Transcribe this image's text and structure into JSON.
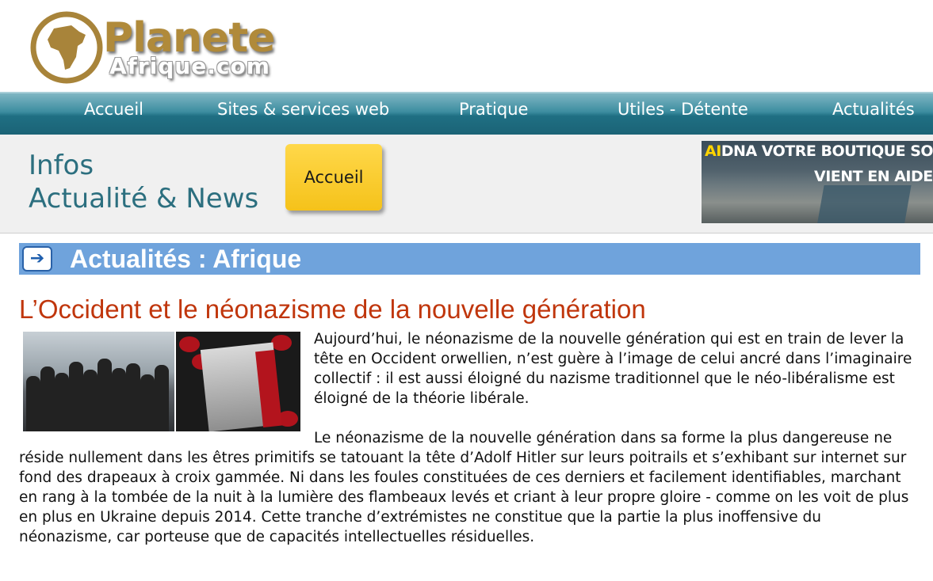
{
  "logo": {
    "main": "Planete",
    "sub": "Afrique.com",
    "icon": "africa-globe-icon"
  },
  "nav": {
    "items": [
      {
        "label": "Accueil"
      },
      {
        "label": "Sites & services web"
      },
      {
        "label": "Pratique"
      },
      {
        "label": "Utiles - Détente"
      },
      {
        "label": "Actualités"
      }
    ]
  },
  "infos": {
    "title_line1": "Infos",
    "title_line2": "Actualité & News",
    "accueil_button": "Accueil"
  },
  "ad": {
    "line1_accent": "AI",
    "line1_rest": "DNA VOTRE BOUTIQUE SO",
    "line2": "VIENT EN AIDE"
  },
  "section": {
    "title": "Actualités : Afrique",
    "icon": "arrow-right-icon"
  },
  "article": {
    "title": "L’Occident et le néonazisme de la nouvelle génération",
    "paragraph1": "Aujourd’hui, le néonazisme de la nouvelle génération qui est en train de lever la tête en Occident orwellien, n’est guère à l’image de celui ancré dans l’imaginaire collectif : il est aussi éloigné du nazisme traditionnel que le néo-libéralisme est éloigné de la théorie libérale.",
    "paragraph2": "Le néonazisme de la nouvelle génération dans sa forme la plus dangereuse ne réside nullement dans les êtres primitifs se tatouant la tête d’Adolf Hitler sur leurs poitrails et s’exhibant sur internet sur fond des drapeaux à croix gammée. Ni dans les foules constituées de ces derniers et facilement identifiables, marchant en rang à la tombée de la nuit à la lumière des flambeaux levés et criant à leur propre gloire - comme on les voit de plus en plus en Ukraine depuis 2014. Cette tranche d’extrémistes ne constitue que la partie la plus inoffensive du néonazisme, car porteuse que de capacités intellectuelles résiduelles."
  },
  "colors": {
    "nav_bg": "#2a7d91",
    "section_bar": "#6fa3dc",
    "article_title": "#c0360c",
    "infos_title": "#2c6f7f",
    "accueil_button": "#f5c21a"
  }
}
